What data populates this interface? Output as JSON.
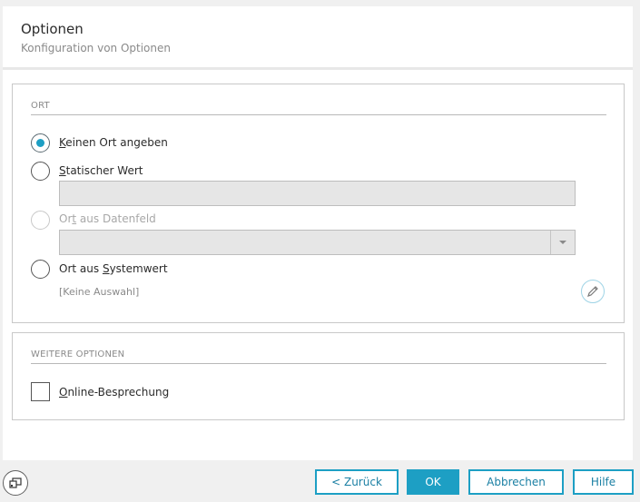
{
  "header": {
    "title": "Optionen",
    "subtitle": "Konfiguration von Optionen"
  },
  "ort": {
    "section_title": "ORT",
    "options": [
      {
        "prefix": "",
        "mnemonic": "K",
        "suffix": "einen Ort angeben",
        "checked": true,
        "disabled": false
      },
      {
        "prefix": "",
        "mnemonic": "S",
        "suffix": "tatischer Wert",
        "checked": false,
        "disabled": false
      },
      {
        "prefix": "Or",
        "mnemonic": "t",
        "suffix": " aus Datenfeld",
        "checked": false,
        "disabled": true
      },
      {
        "prefix": "Ort aus ",
        "mnemonic": "S",
        "suffix": "ystemwert",
        "checked": false,
        "disabled": false
      }
    ],
    "static_value": "",
    "datafield_value": "",
    "system_value_hint": "[Keine Auswahl]",
    "edit_icon": "pencil-icon"
  },
  "weitere": {
    "section_title": "WEITERE OPTIONEN",
    "online_prefix": "",
    "online_mnemonic": "O",
    "online_suffix": "nline-Besprechung",
    "online_checked": false
  },
  "footer": {
    "corner_icon": "window-switch-icon",
    "back": "< Zurück",
    "ok": "OK",
    "cancel": "Abbrechen",
    "help": "Hilfe"
  },
  "colors": {
    "accent": "#1d9fc4",
    "background": "#f0f0f0"
  }
}
